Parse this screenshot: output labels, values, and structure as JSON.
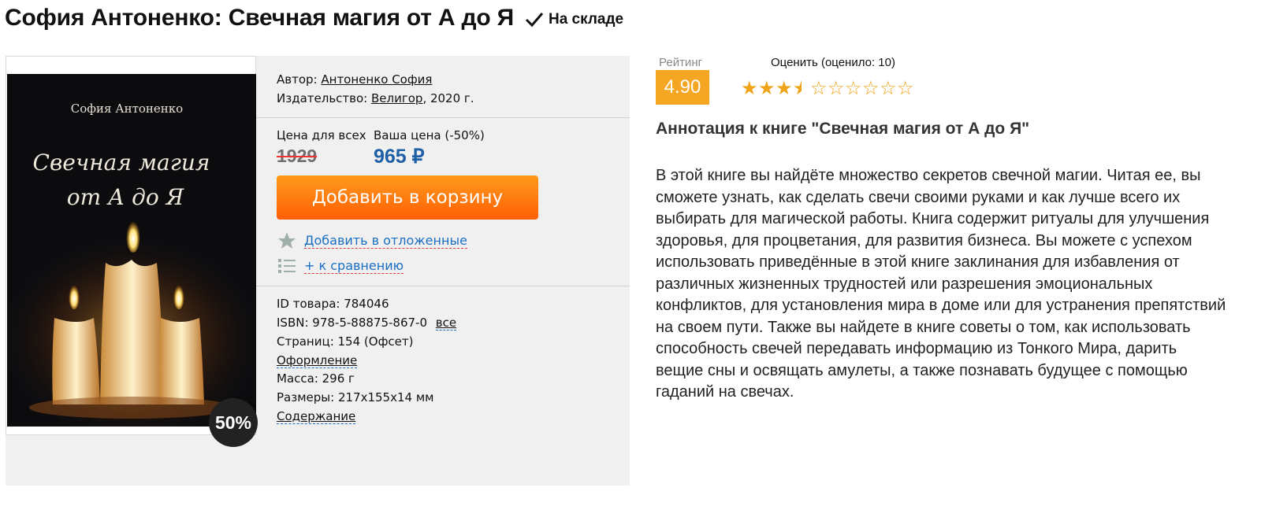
{
  "title": "София Антоненко: Свечная магия от А до Я",
  "stock": "На складе",
  "cover": {
    "author": "София Антоненко",
    "title_line1": "Свечная магия",
    "title_line2": "от А до Я",
    "discount_badge": "50%"
  },
  "details": {
    "author_label": "Автор:",
    "author": "Антоненко София",
    "publisher_label": "Издательство:",
    "publisher": "Велигор",
    "year": ", 2020 г."
  },
  "pricing": {
    "price_all_label": "Цена для всех",
    "your_price_label": "Ваша цена (-50%)",
    "old_price": "1929",
    "new_price": "965 ₽",
    "add_to_cart": "Добавить в корзину",
    "wishlist": "Добавить в отложенные",
    "compare": "+ к сравнению"
  },
  "specs": {
    "id_line": "ID товара: 784046",
    "isbn_line": "ISBN: 978-5-88875-867-0",
    "isbn_all": "все",
    "pages_line": "Страниц: 154 (Офсет)",
    "design_link": "Оформление",
    "mass_line": "Масса: 296 г",
    "size_line": "Размеры: 217x155x14 мм",
    "contents_link": "Содержание"
  },
  "rating": {
    "label": "Рейтинг",
    "value": "4.90",
    "rate_prompt": "Оценить (оценило: 10)",
    "stars_filled": 3.5,
    "stars_total": 10
  },
  "annotation": {
    "title": "Аннотация к книге \"Свечная магия от А до Я\"",
    "text": "В этой книге вы найдёте множество секретов свечной магии. Читая ее, вы сможете узнать, как сделать свечи своими руками и как лучше всего их выбирать для магической работы. Книга содержит ритуалы для улучшения здоровья, для процветания, для развития бизнеса. Вы можете с успехом использовать приведённые в этой книге заклинания для избавления от различных жизненных трудностей или разрешения эмоциональных конфликтов, для установления мира в доме или для устранения препятствий на своем пути. Также вы найдете в книге советы о том, как использовать способность свечей передавать информацию из Тонкого Мира, дарить вещие сны и освящать амулеты, а также познавать будущее с помощью гаданий на свечах."
  },
  "colors": {
    "accent_orange": "#ff6a0a",
    "price_blue": "#1f5fa6",
    "rating_bg": "#f5a623"
  }
}
